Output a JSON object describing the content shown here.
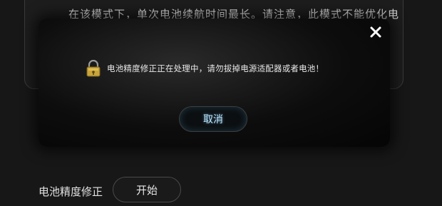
{
  "background": {
    "description_text": "在该模式下，单次电池续航时间最长。请注意，此模式不能优化电",
    "calibration_label": "电池精度修正",
    "start_button_label": "开始"
  },
  "modal": {
    "message": "电池精度修正正在处理中，请勿拔掉电源适配器或者电池！",
    "cancel_label": "取消",
    "close_icon": "close-icon",
    "status_icon": "lock-warning-icon"
  },
  "colors": {
    "background": "#171717",
    "modal": "#0b0b0b",
    "cancel_text": "#bfe8ff"
  }
}
